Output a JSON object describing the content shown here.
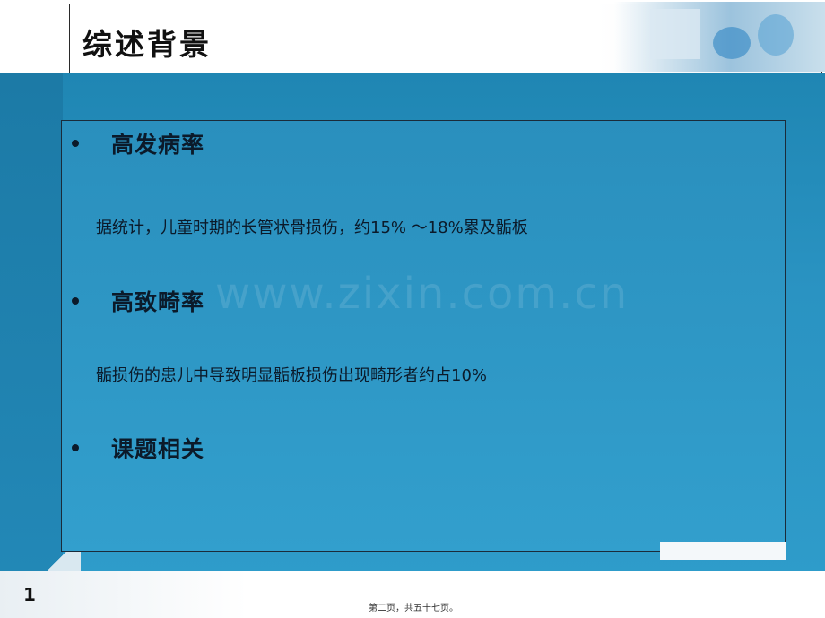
{
  "slide": {
    "title": "综述背景",
    "sections": [
      {
        "heading": "高发病率",
        "text": "据统计，儿童时期的长管状骨损伤，约15% ～18%累及骺板"
      },
      {
        "heading": "高致畸率",
        "text": "骺损伤的患儿中导致明显骺板损伤出现畸形者约占10%"
      },
      {
        "heading": "课题相关",
        "text": ""
      }
    ],
    "watermark": "www.zixin.com.cn",
    "slide_number": "1",
    "footer": "第二页，共五十七页。"
  },
  "colors": {
    "background_blue": "#2a93c2",
    "text_dark": "#0b1a2a",
    "title_bg": "#ffffff"
  }
}
